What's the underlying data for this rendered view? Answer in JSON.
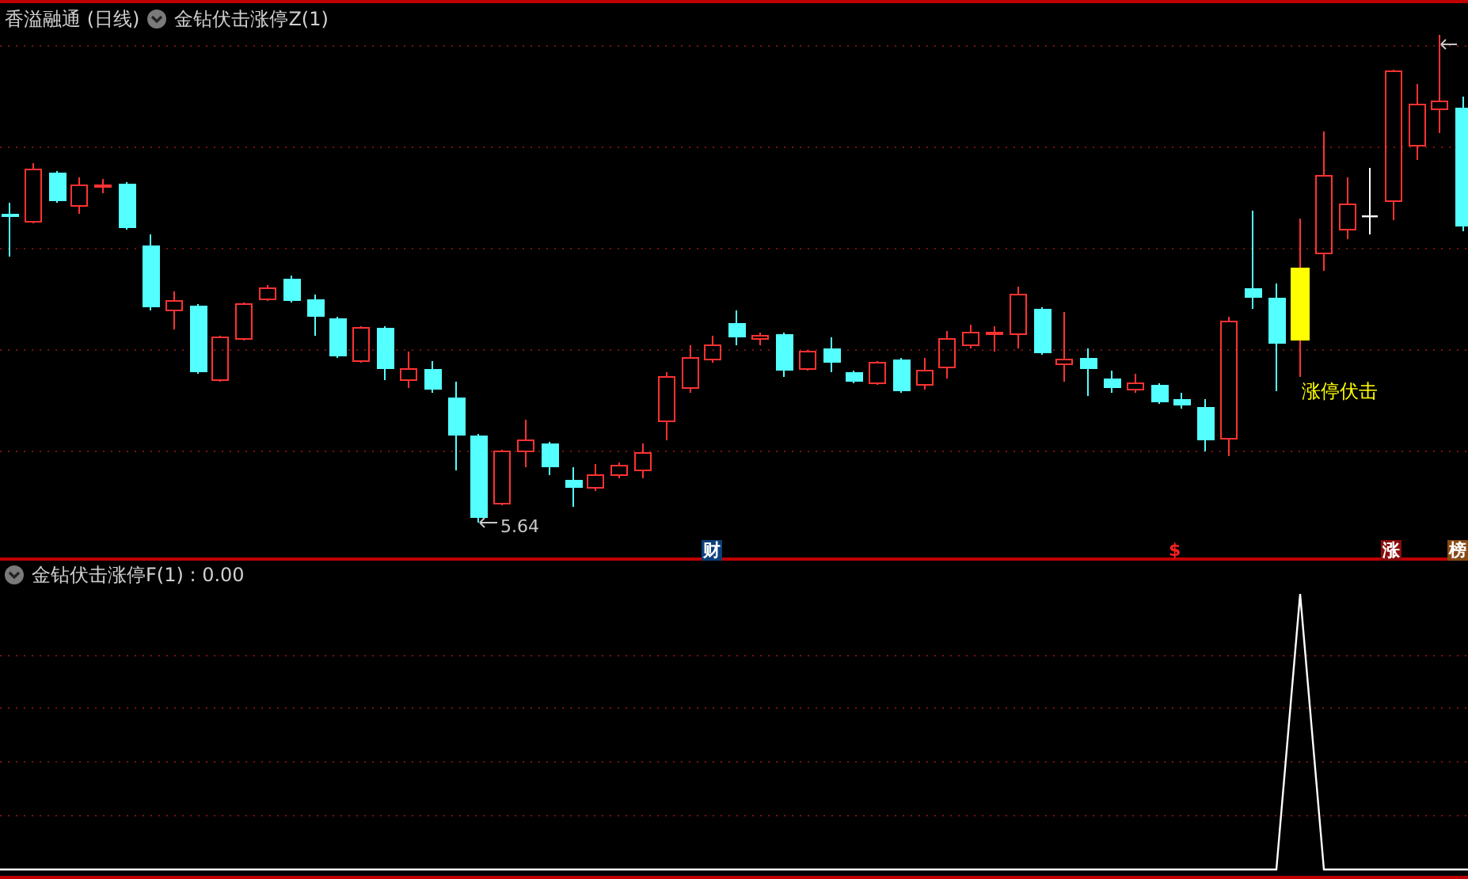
{
  "main_pane": {
    "header": {
      "instrument": "香溢融通",
      "period": "(日线)",
      "indicator": "金钻伏击涨停Z(1)"
    },
    "low_label": "5.64",
    "signal_label": "涨停伏击",
    "markers": [
      {
        "text": "财",
        "kind": "badge",
        "color": "#0d3f7a"
      },
      {
        "text": "$",
        "kind": "glyph",
        "color": "#ff2020"
      },
      {
        "text": "涨",
        "kind": "badge",
        "color": "#8a0c0c"
      },
      {
        "text": "榜",
        "kind": "badge",
        "color": "#8a4a14"
      }
    ]
  },
  "lower_pane": {
    "header": "金钻伏击涨停F(1) : 0.00"
  }
}
